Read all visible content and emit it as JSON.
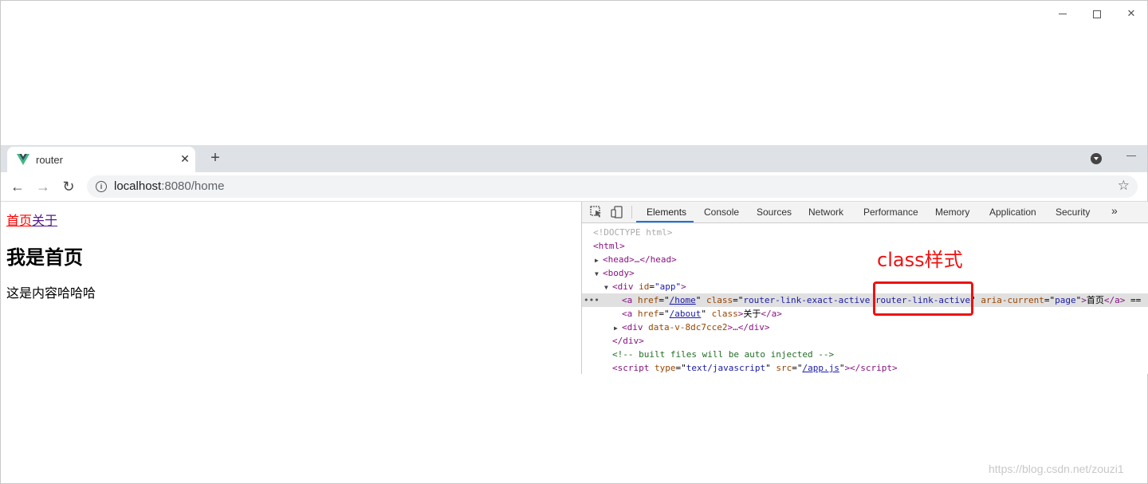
{
  "browser": {
    "tab_title": "router",
    "url_host": "localhost",
    "url_rest": ":8080/home",
    "new_tab": "+",
    "close_tab": "✕"
  },
  "page": {
    "nav_home": "首页",
    "nav_about": "关于",
    "heading": "我是首页",
    "text": "这是内容哈哈哈"
  },
  "devtools": {
    "tabs": [
      "Elements",
      "Console",
      "Sources",
      "Network",
      "Performance",
      "Memory",
      "Application",
      "Security"
    ],
    "more": "»",
    "dom": {
      "doctype": "<!DOCTYPE html>",
      "html_open": "<html>",
      "head": "<head>…</head>",
      "body_open": "<body>",
      "div_open_tag": "<div ",
      "div_id_attr": "id",
      "div_id_val": "\"app\"",
      "a_home_href": "/home",
      "a_home_class": "router-link-exact-active router-link-active",
      "a_home_aria": "page",
      "a_home_text": "首页",
      "a_about_href": "/about",
      "a_about_text": "关于",
      "div_data_attr": "data-v-8dc7cce2",
      "div_close": "</div>",
      "comment": "<!-- built files will be auto injected -->",
      "script_type": "text/javascript",
      "script_src": "/app.js"
    }
  },
  "annotation": {
    "label": "class样式"
  },
  "watermark": "https://blog.csdn.net/zouzi1",
  "colors": {
    "annotation": "#ee1111",
    "active_link": "#ff0000",
    "visited_link": "#551a8b",
    "tab_underline": "#1a73e8"
  }
}
